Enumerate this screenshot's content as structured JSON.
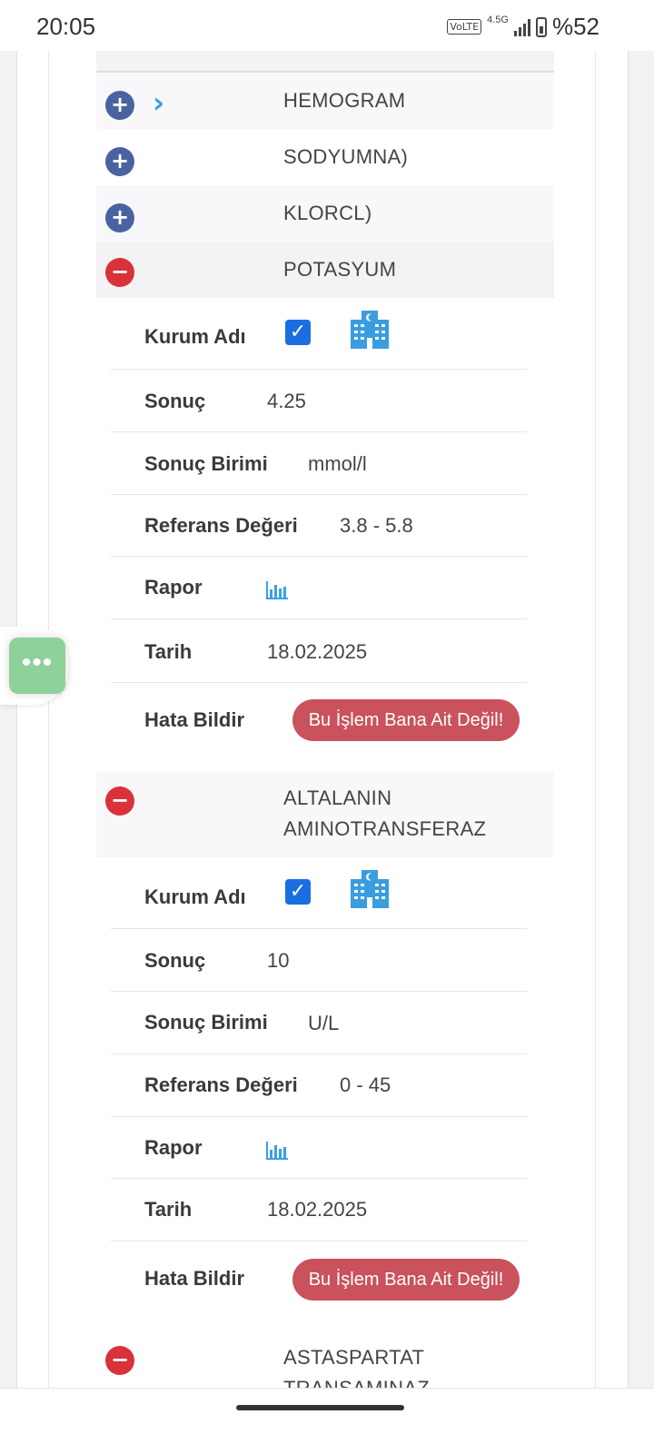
{
  "status_bar": {
    "time": "20:05",
    "volte": "VoLTE",
    "network": "4.5G",
    "battery": "%52"
  },
  "rows": [
    {
      "title": "HEMOGRAM",
      "toggle": "+",
      "state": "collapsed"
    },
    {
      "title": "SODYUMNA)",
      "toggle": "+",
      "state": "collapsed"
    },
    {
      "title": "KLORCL)",
      "toggle": "+",
      "state": "collapsed"
    },
    {
      "title": "POTASYUM",
      "toggle": "−",
      "state": "expanded"
    },
    {
      "title_line1": "ALTALANIN",
      "title_line2": "AMINOTRANSFERAZ",
      "toggle": "−",
      "state": "expanded"
    },
    {
      "title_line1": "ASTASPARTAT",
      "title_line2": "TRANSAMINAZ",
      "toggle": "−",
      "state": "expanded"
    }
  ],
  "labels": {
    "institution": "Kurum Adı",
    "result": "Sonuç",
    "unit": "Sonuç Birimi",
    "reference": "Referans Değeri",
    "report": "Rapor",
    "date": "Tarih",
    "report_error": "Hata Bildir",
    "not_mine_button": "Bu İşlem Bana Ait Değil!"
  },
  "details": [
    {
      "result": "4.25",
      "unit": "mmol/l",
      "reference": "3.8 - 5.8",
      "date": "18.02.2025",
      "checked": true
    },
    {
      "result": "10",
      "unit": "U/L",
      "reference": "0 - 45",
      "date": "18.02.2025",
      "checked": true
    }
  ],
  "icons": {
    "expand": "chevron-right-icon",
    "institution": "hospital-icon",
    "report": "bar-chart-icon",
    "menu": "more-horizontal-icon",
    "checkbox": "checkmark-icon"
  },
  "colors": {
    "plus_toggle": "#4a63a0",
    "minus_toggle": "#d9323a",
    "checkbox": "#1a6fe0",
    "report_button": "#c9525c",
    "icon_blue": "#3aa0e6",
    "floating_button": "#8fd19a"
  }
}
